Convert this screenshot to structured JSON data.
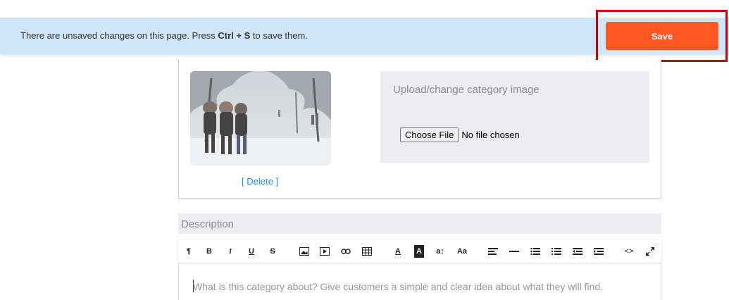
{
  "banner": {
    "text_before": "There are unsaved changes on this page. Press ",
    "key1": "Ctrl",
    "plus": " + ",
    "key2": "S",
    "text_after": " to save them.",
    "save_label": "Save"
  },
  "image_section": {
    "delete_label": "[ Delete ]",
    "upload_title": "Upload/change category image",
    "choose_file_label": "Choose File",
    "file_status": "No file chosen"
  },
  "description": {
    "label": "Description",
    "placeholder": "What is this category about? Give customers a simple and clear idea about what they will find."
  },
  "toolbar": {
    "paragraph": "¶",
    "bold": "B",
    "italic": "I",
    "underline": "U",
    "strikethrough": "S",
    "font_color": "A",
    "background_color": "A",
    "font_size": "a↕",
    "text_case": "Aa",
    "code_view": "<>"
  },
  "colors": {
    "banner_bg": "#cfe6f8",
    "save_bg": "#ff5722",
    "highlight": "#cc0000",
    "link": "#1a8fd6"
  }
}
